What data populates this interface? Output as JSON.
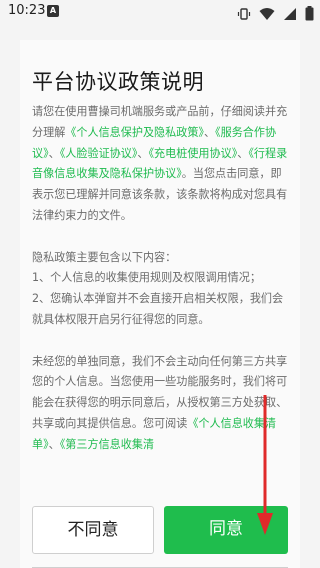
{
  "status_bar": {
    "time": "10:23",
    "indicator": "A",
    "icons": [
      "vibrate-icon",
      "wifi-icon",
      "signal-icon",
      "battery-icon"
    ]
  },
  "dialog": {
    "title": "平台协议政策说明",
    "para1": {
      "text1": "请您在使用曹操司机端服务或产品前，仔细阅读并充分理解",
      "link1": "《个人信息保护及隐私政策》",
      "sep1": "、",
      "link2": "《服务合作协议》",
      "sep2": "、",
      "link3": "《人脸验证协议》",
      "sep3": "、",
      "link4": "《充电桩使用协议》",
      "sep4": "、",
      "link5": "《行程录音像信息收集及隐私保护协议》",
      "text2": "。当您点击同意，即表示您已理解并同意该条款，该条款将构成对您具有法律约束力的文件。"
    },
    "para2": {
      "line1": "隐私政策主要包含以下内容：",
      "line2": "1、个人信息的收集使用规则及权限调用情况；",
      "line3": "2、您确认本弹窗并不会直接开启相关权限，我们会就具体权限开启另行征得您的同意。"
    },
    "para3": {
      "text1": "未经您的单独同意，我们不会主动向任何第三方共享您的个人信息。当您使用一些功能服务时，我们将可能会在获得您的明示同意后，从授权第三方处获取、共享或向其提供信息。您可阅读",
      "link1": "《个人信息收集清单》",
      "sep1": "、",
      "link2": "《第三方信息收集清"
    },
    "disagree_label": "不同意",
    "agree_label": "同意"
  },
  "colors": {
    "accent_green": "#1fbd4d",
    "annotation_red": "#e02a2a"
  }
}
